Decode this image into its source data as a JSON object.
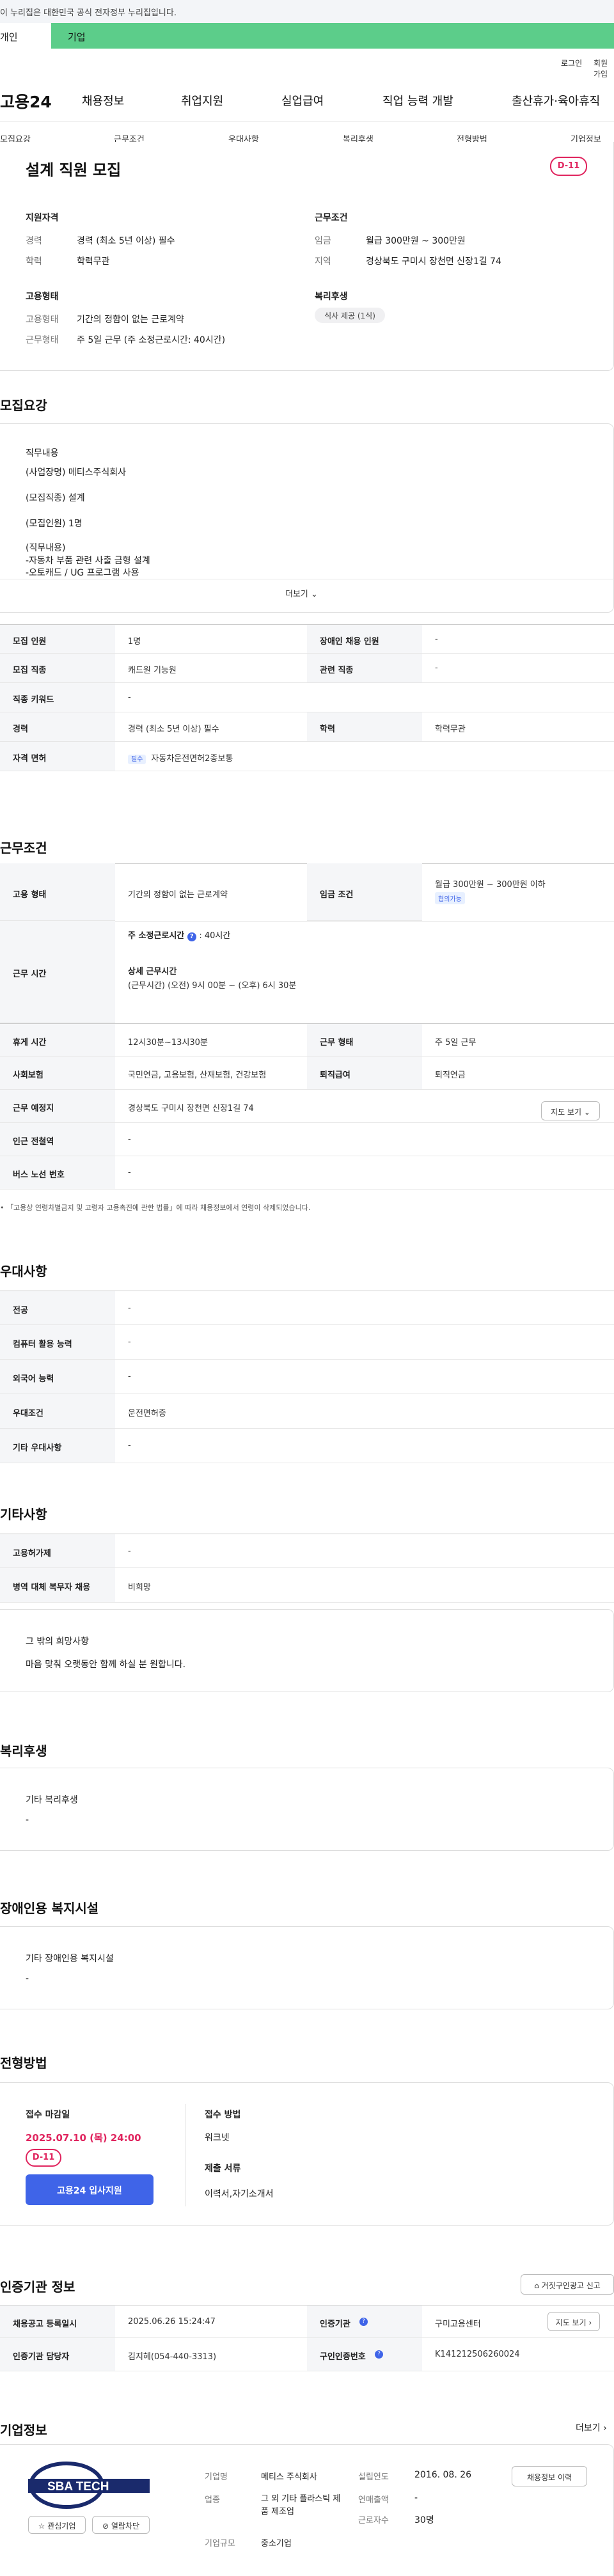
{
  "header": {
    "gov_notice": "이 누리집은 대한민국 공식 전자정부 누리집입니다.",
    "tab_person": "개인",
    "tab_company": "기업",
    "login": "로그인",
    "join": "회원가입",
    "logo": "고용24",
    "nav": [
      "채용정보",
      "취업지원",
      "실업급여",
      "직업 능력 개발",
      "출산휴가·육아휴직"
    ],
    "subnav": [
      "모집요강",
      "근무조건",
      "우대사항",
      "복리후생",
      "전형방법",
      "기업정보"
    ]
  },
  "summary": {
    "title": "설계 직원 모집",
    "dday": "D-11",
    "qual_title": "지원자격",
    "qual_career_label": "경력",
    "qual_career_value": "경력 (최소 5년 이상) 필수",
    "qual_edu_label": "학력",
    "qual_edu_value": "학력무관",
    "cond_title": "근무조건",
    "cond_wage_label": "임금",
    "cond_wage_value": "월급 300만원 ~ 300만원",
    "cond_area_label": "지역",
    "cond_area_value": "경상북도 구미시 장천면 신장1길 74",
    "emp_title": "고용형태",
    "emp_type_label": "고용형태",
    "emp_type_value": "기간의 정함이 없는 근로계약",
    "emp_work_label": "근무형태",
    "emp_work_value": "주 5일 근무 (주 소정근로시간: 40시간)",
    "welfare_title": "복리후생",
    "welfare_pill": "식사 제공 (1식)"
  },
  "recruit": {
    "title": "모집요강",
    "job_title": "직무내용",
    "lines": [
      "(사업장명) 메티스주식회사",
      "(모집직종) 설계",
      "(모집인원) 1명",
      "(직무내용)",
      "-자동차 부품 관련 사출 금형 설계",
      "-오토캐드 / UG 프로그램 사용"
    ],
    "more": "더보기",
    "rows": [
      [
        "모집 인원",
        "1명",
        "장애인 채용 인원",
        "-"
      ],
      [
        "모집 직종",
        "캐드원 기능원",
        "관련 직종",
        "-"
      ],
      [
        "직종 키워드",
        "-",
        "",
        ""
      ],
      [
        "경력",
        "경력 (최소 5년 이상) 필수",
        "학력",
        "학력무관"
      ],
      [
        "자격 면허",
        "자동차운전면허2종보통",
        "",
        ""
      ]
    ],
    "license_tag": "필수"
  },
  "work": {
    "title": "근무조건",
    "emp_label": "고용 형태",
    "emp_value": "기간의 정함이 없는 근로계약",
    "wage_label": "임금 조건",
    "wage_value": "월급 300만원 ~ 300만원 이하",
    "wage_tag": "협의가능",
    "hours_label": "근무 시간",
    "hours_week": "주 소정근로시간",
    "hours_week_value": ": 40시간",
    "hours_detail_title": "상세 근무시간",
    "hours_detail": "(근무시간) (오전) 9시 00분 ~ (오후) 6시 30분",
    "rows": [
      [
        "휴게 시간",
        "12시30분~13시30분",
        "근무 형태",
        "주 5일 근무"
      ],
      [
        "사회보험",
        "국민연금, 고용보험, 산재보험, 건강보험",
        "퇴직급여",
        "퇴직연금"
      ],
      [
        "근무 예정지",
        "경상북도 구미시 장천면 신장1길 74",
        "",
        ""
      ],
      [
        "인근 전철역",
        "-",
        "",
        ""
      ],
      [
        "버스 노선 번호",
        "-",
        "",
        ""
      ]
    ],
    "map_btn": "지도 보기",
    "note": "「고용상 연령차별금지 및 고령자 고용촉진에 관한 법률」에 따라 채용정보에서 연령이 삭제되었습니다."
  },
  "pref": {
    "title": "우대사항",
    "rows": [
      [
        "전공",
        "-"
      ],
      [
        "컴퓨터 활용 능력",
        "-"
      ],
      [
        "외국어 능력",
        "-"
      ],
      [
        "우대조건",
        "운전면허증"
      ],
      [
        "기타 우대사항",
        "-"
      ]
    ]
  },
  "etc": {
    "title": "기타사항",
    "rows": [
      [
        "고용허가제",
        "-"
      ],
      [
        "병역 대체 복무자 채용",
        "비희망"
      ]
    ],
    "box_title": "그 밖의 희망사항",
    "box_text": "마음 맞춰 오랫동안 함께 하실 분 원합니다."
  },
  "welfare": {
    "title": "복리후생",
    "box_title": "기타 복리후생",
    "box_text": "-"
  },
  "disab": {
    "title": "장애인용 복지시설",
    "box_title": "기타 장애인용 복지시설",
    "box_text": "-"
  },
  "apply": {
    "title": "전형방법",
    "deadline_label": "접수 마감일",
    "deadline": "2025.07.10 (목) 24:00",
    "dday": "D-11",
    "apply_btn": "고용24 입사지원",
    "method_label": "접수 방법",
    "method": "워크넷",
    "docs_label": "제출 서류",
    "docs": "이력서,자기소개서"
  },
  "cert": {
    "title": "인증기관 정보",
    "report_btn": "거짓구인광고 신고",
    "rows": [
      [
        "채용공고 등록일시",
        "2025.06.26 15:24:47",
        "인증기관",
        "구미고용센터"
      ],
      [
        "인증기관 담당자",
        "김지혜(054-440-3313)",
        "구인인증번호",
        "K141212506260024"
      ]
    ],
    "map_btn": "지도 보기"
  },
  "company": {
    "title": "기업정보",
    "more": "더보기",
    "logo_text": "SBA TECH",
    "fav_btn": "관심기업",
    "block_btn": "열람차단",
    "name_label": "기업명",
    "name": "메티스 주식회사",
    "industry_label": "업종",
    "industry": "그 외 기타 플라스틱 제품 제조업",
    "size_label": "기업규모",
    "size": "중소기업",
    "founded_label": "설립연도",
    "founded": "2016. 08. 26",
    "sales_label": "연매출액",
    "sales": "-",
    "emp_label": "근로자수",
    "emp": "30명",
    "history_btn": "채용정보 이력"
  }
}
